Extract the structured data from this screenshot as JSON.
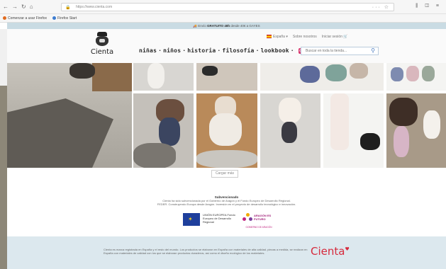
{
  "browser": {
    "url": "https://www.cienta.com",
    "nav_icons": [
      "back-arrow-icon",
      "forward-arrow-icon",
      "reload-icon",
      "home-icon"
    ],
    "bookmarks": [
      "Comenzar a usar Firefox",
      "Firefox Start"
    ]
  },
  "promo": {
    "prefix": "Envío",
    "highlight": "GRATUITO 48h",
    "suffix": "desde 40€ a GAYES"
  },
  "header": {
    "logo_text": "Cienta",
    "nav": [
      "niñas",
      "niños",
      "historia",
      "filosofía",
      "lookbook"
    ],
    "language": "España",
    "account": "Sobre nosotros",
    "cart": "Iniciar sesión",
    "search_placeholder": "Buscar en toda la tienda..."
  },
  "load_more": "Cargar más",
  "eu": {
    "title": "Subvencionado",
    "text_line1": "Cienta ha sido subvencionada por el Gobierno de Aragón y el Fondo Europeo de Desarrollo Regional.",
    "text_line2": "FEDER. Construyendo Europa desde Aragón. Inversión en el proyecto de desarrollo tecnológico e innovación.",
    "eu_label": "UNIÓN EUROPEA Fondo Europeo de Desarrollo Regional",
    "aragon_label": "ARAGÓN ES FUTURO",
    "aragon_sub": "GOBIERNO DE ARAGÓN"
  },
  "footer": {
    "text": "Cienta es marca registrada en España y el resto del mundo. Los productos se elaboran en España con materiales de alta calidad, piezas a medida, se realizan en España con materiales de calidad con los que se elaboran productos duraderos, así como el diseño ecológico de los materiales.",
    "logo": "Cienta"
  },
  "colors": {
    "promo_bg": "#c9dbe3",
    "footer_bg": "#dce8ee",
    "brand_red": "#d62a3c",
    "search_blue": "#4a7cc0"
  }
}
